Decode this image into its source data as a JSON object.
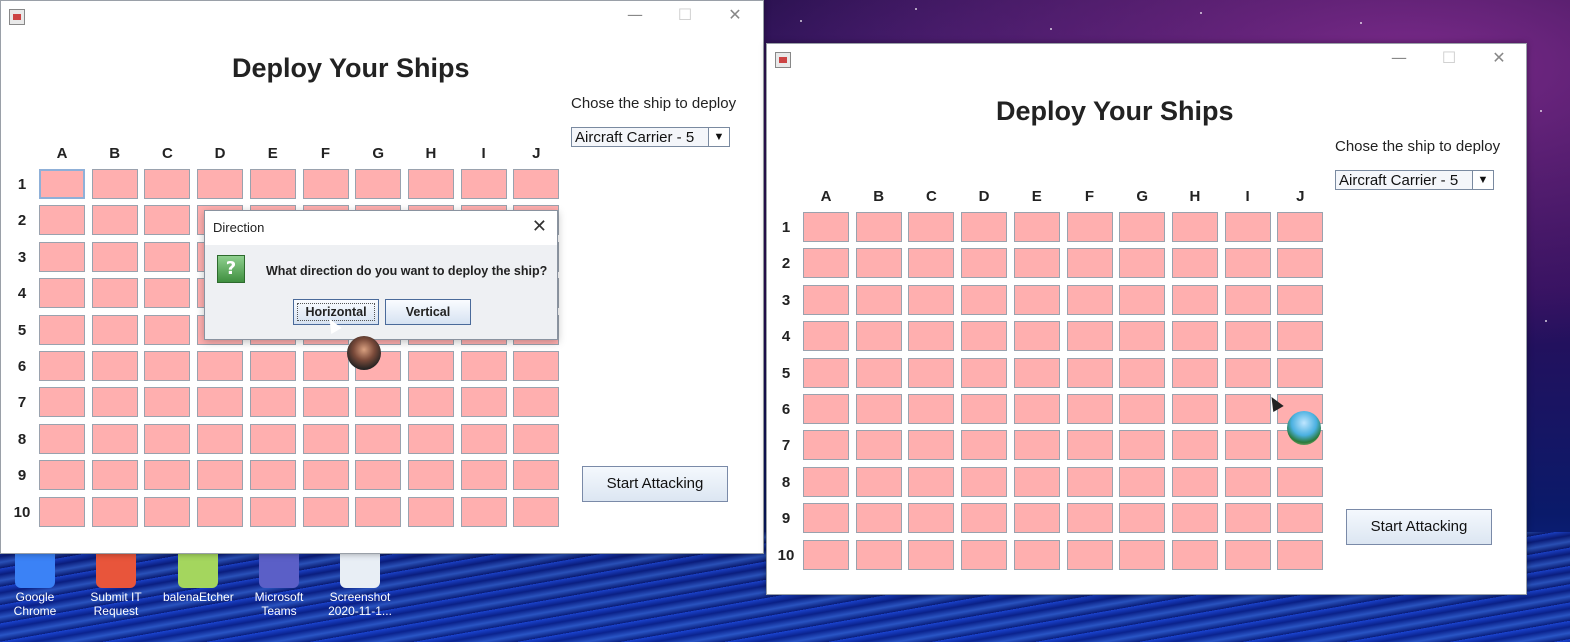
{
  "desktop": {
    "icons": [
      {
        "label_line1": "Google",
        "label_line2": "Chrome",
        "color": "#3b82f6"
      },
      {
        "label_line1": "Submit IT",
        "label_line2": "Request",
        "color": "#e8553b"
      },
      {
        "label_line1": "balenaEtcher",
        "label_line2": "",
        "color": "#a4d65e"
      },
      {
        "label_line1": "Microsoft",
        "label_line2": "Teams",
        "color": "#5b5fc7"
      },
      {
        "label_line1": "Screenshot",
        "label_line2": "2020-11-1...",
        "color": "#e8eef5"
      }
    ]
  },
  "left_window": {
    "title": "Deploy Your Ships",
    "chose_label": "Chose the ship to deploy",
    "ship_select_value": "Aircraft Carrier - 5",
    "start_button": "Start Attacking",
    "minimize": "—",
    "maximize": "☐",
    "close": "✕"
  },
  "right_window": {
    "title": "Deploy Your Ships",
    "chose_label": "Chose the ship to deploy",
    "ship_select_value": "Aircraft Carrier - 5",
    "start_button": "Start Attacking",
    "minimize": "—",
    "maximize": "☐",
    "close": "✕"
  },
  "grid": {
    "columns": [
      "A",
      "B",
      "C",
      "D",
      "E",
      "F",
      "G",
      "H",
      "I",
      "J"
    ],
    "rows": [
      "1",
      "2",
      "3",
      "4",
      "5",
      "6",
      "7",
      "8",
      "9",
      "10"
    ],
    "cell_color": "#ffafaf"
  },
  "dialog": {
    "title": "Direction",
    "close": "✕",
    "icon": "?",
    "message": "What direction do you want to deploy the ship?",
    "buttons": [
      "Horizontal",
      "Vertical"
    ]
  }
}
